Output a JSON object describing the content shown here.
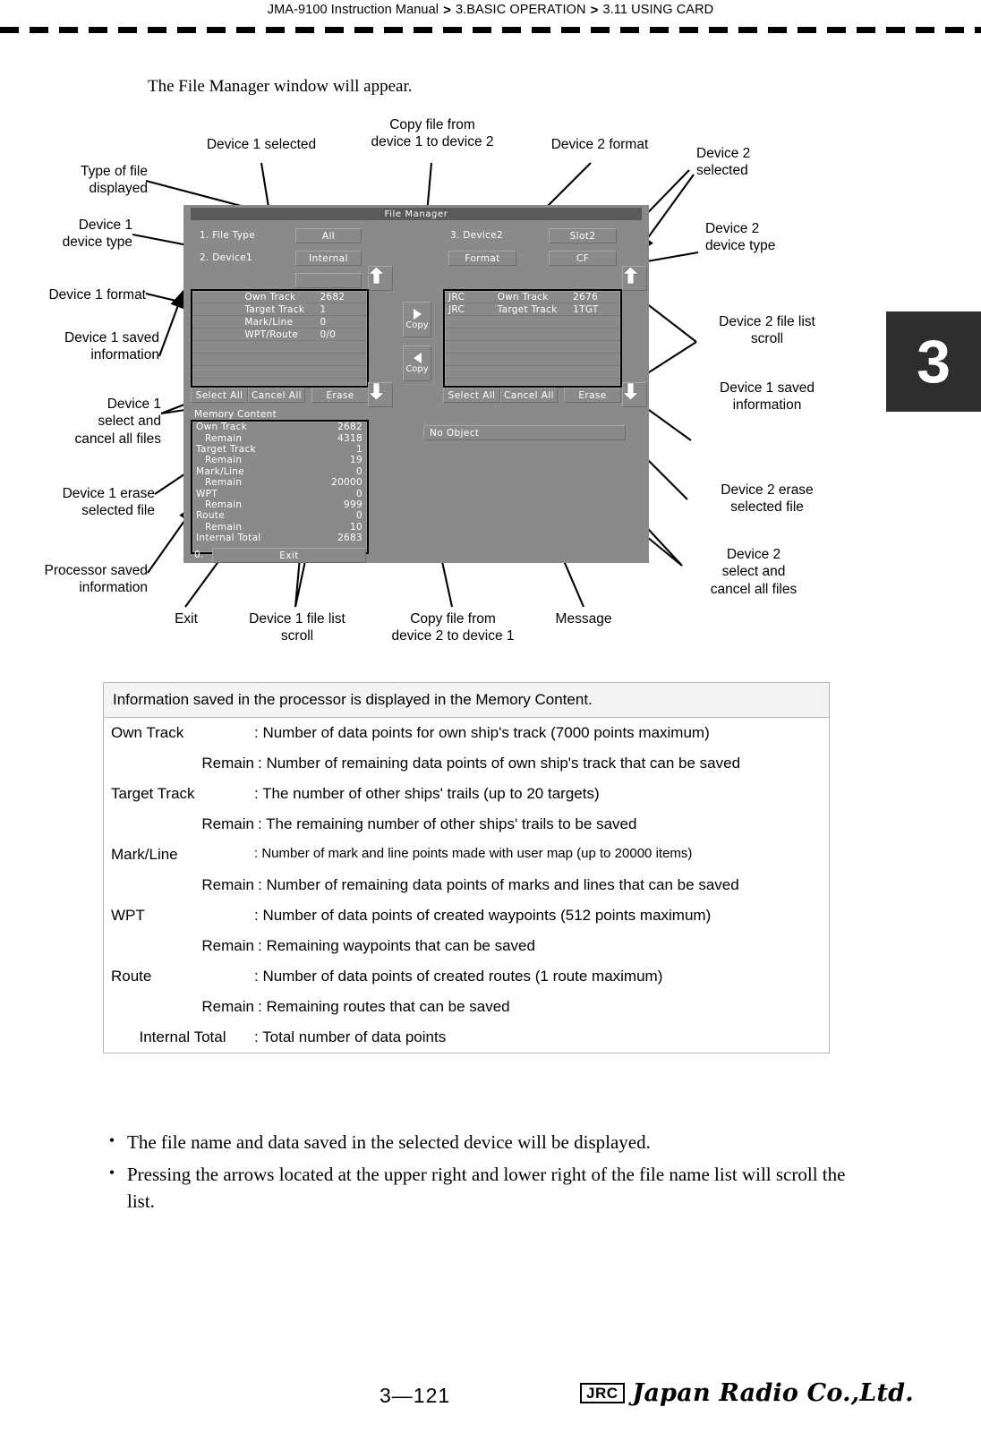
{
  "header": {
    "manual": "JMA-9100 Instruction Manual",
    "sep1": ">",
    "chapter": "3.BASIC OPERATION",
    "sep2": ">",
    "section": "3.11  USING CARD"
  },
  "chapter_tab": "3",
  "intro_text": "The File Manager window will appear.",
  "file_manager": {
    "title": "File  Manager",
    "file_type_label": "1.  File  Type",
    "file_type_value": "All",
    "device1_label": "2.  Device1",
    "device1_value": "Internal",
    "device1_format_value": "",
    "device2_label": "3.  Device2",
    "device2_value": "Slot2",
    "device2_format_button": "Format",
    "device2_format_value": "CF",
    "copy_right_label": "Copy",
    "copy_left_label": "Copy",
    "device1_list": [
      {
        "name": "",
        "type": "Own  Track",
        "value": "2682"
      },
      {
        "name": "",
        "type": "Target  Track",
        "value": "1"
      },
      {
        "name": "",
        "type": "Mark/Line",
        "value": "0"
      },
      {
        "name": "",
        "type": "WPT/Route",
        "value": "0/0"
      }
    ],
    "device2_list": [
      {
        "name": "JRC",
        "type": "Own  Track",
        "value": "2676"
      },
      {
        "name": "JRC",
        "type": "Target  Track",
        "value": "1TGT"
      }
    ],
    "device1_buttons": {
      "select_all": "Select  All",
      "cancel_all": "Cancel  All",
      "erase": "Erase"
    },
    "device2_buttons": {
      "select_all": "Select  All",
      "cancel_all": "Cancel  All",
      "erase": "Erase"
    },
    "memory_content_label": "Memory  Content",
    "memory_content": [
      {
        "label": "Own  Track",
        "value": "2682",
        "indent": false
      },
      {
        "label": "Remain",
        "value": "4318",
        "indent": true
      },
      {
        "label": "Target  Track",
        "value": "1",
        "indent": false
      },
      {
        "label": "Remain",
        "value": "19",
        "indent": true
      },
      {
        "label": "Mark/Line",
        "value": "0",
        "indent": false
      },
      {
        "label": "Remain",
        "value": "20000",
        "indent": true
      },
      {
        "label": "WPT",
        "value": "0",
        "indent": false
      },
      {
        "label": "Remain",
        "value": "999",
        "indent": true
      },
      {
        "label": "Route",
        "value": "0",
        "indent": false
      },
      {
        "label": "Remain",
        "value": "10",
        "indent": true
      },
      {
        "label": "Internal  Total",
        "value": "2683",
        "indent": false
      }
    ],
    "message_value": "No  Object",
    "exit_index": "0.",
    "exit_label": "Exit"
  },
  "callouts": {
    "type_of_file_displayed": "Type of file\ndisplayed",
    "device1_device_type": "Device 1\ndevice type",
    "device1_format": "Device 1 format",
    "device1_saved_information": "Device 1 saved\ninformation",
    "device1_select_cancel": "Device 1\nselect and\ncancel all files",
    "device1_erase": "Device 1 erase\nselected file",
    "processor_saved_information": "Processor saved\ninformation",
    "device1_selected": "Device 1 selected",
    "copy_1_to_2": "Copy file from\ndevice 1 to device 2",
    "device2_format": "Device 2 format",
    "device2_selected": "Device 2\nselected",
    "device2_device_type": "Device 2\ndevice type",
    "device2_file_list_scroll": "Device 2 file list\nscroll",
    "device1_saved_information_right": "Device 1 saved\ninformation",
    "device2_erase": "Device 2 erase\nselected file",
    "device2_select_cancel": "Device 2\nselect and\ncancel all files",
    "exit": "Exit",
    "device1_file_list_scroll": "Device 1  file list\nscroll",
    "copy_2_to_1": "Copy file from\ndevice 2 to device 1",
    "message": "Message"
  },
  "desc_table": {
    "header": "Information saved in the processor is displayed in the Memory Content.",
    "rows": [
      {
        "term": "Own Track",
        "indent": false,
        "desc": ": Number of data points for own ship's track (7000 points maximum)",
        "small": false
      },
      {
        "term": "Remain",
        "indent": true,
        "desc": ": Number of remaining data points of own ship's track that can be saved",
        "small": false
      },
      {
        "term": "Target Track",
        "indent": false,
        "desc": ": The number of other ships' trails (up to 20 targets)",
        "small": false
      },
      {
        "term": "Remain",
        "indent": true,
        "desc": ": The remaining number of other ships' trails to be saved",
        "small": false
      },
      {
        "term": "Mark/Line",
        "indent": false,
        "desc": ": Number of mark and line points made with user map (up to 20000 items)",
        "small": true
      },
      {
        "term": "Remain",
        "indent": true,
        "desc": ": Number of remaining data points of marks and lines that can be saved",
        "small": false
      },
      {
        "term": "WPT",
        "indent": false,
        "desc": ": Number of data points of created waypoints (512 points maximum)",
        "small": false
      },
      {
        "term": "Remain",
        "indent": true,
        "desc": ": Remaining waypoints that can be saved",
        "small": false
      },
      {
        "term": "Route",
        "indent": false,
        "desc": ": Number of data points of created routes (1 route maximum)",
        "small": false
      },
      {
        "term": "Remain",
        "indent": true,
        "desc": ": Remaining routes that can be saved",
        "small": false
      },
      {
        "term": "Internal Total",
        "indent": false,
        "center": true,
        "desc": ": Total number of data points",
        "small": false
      }
    ]
  },
  "bullets": [
    "The file name and data saved in the selected device will be displayed.",
    "Pressing the arrows located at the upper right and lower right of the file name list will scroll the list."
  ],
  "bullet_marker": "•",
  "footer": {
    "page_number": "3—121",
    "jrc_mark": "JRC",
    "company": "Japan Radio Co.,Ltd."
  }
}
